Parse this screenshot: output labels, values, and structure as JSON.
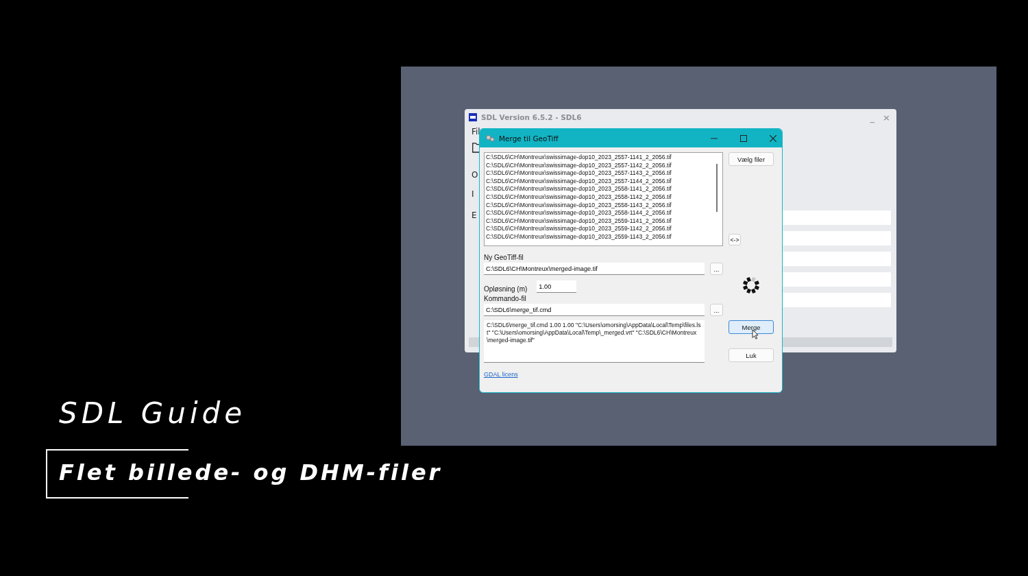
{
  "overlay": {
    "heading": "SDL Guide",
    "subtitle": "Flet billede- og DHM-filer"
  },
  "background_window": {
    "title": "SDL Version 6.5.2 - SDL6",
    "minimize_glyph": "_",
    "close_glyph": "×",
    "partial_labels": [
      "Fil",
      "O",
      "I",
      "E"
    ]
  },
  "dialog": {
    "title": "Merge til GeoTiff",
    "files": [
      "C:\\SDL6\\CH\\Montreux\\swissimage-dop10_2023_2557-1141_2_2056.tif",
      "C:\\SDL6\\CH\\Montreux\\swissimage-dop10_2023_2557-1142_2_2056.tif",
      "C:\\SDL6\\CH\\Montreux\\swissimage-dop10_2023_2557-1143_2_2056.tif",
      "C:\\SDL6\\CH\\Montreux\\swissimage-dop10_2023_2557-1144_2_2056.tif",
      "C:\\SDL6\\CH\\Montreux\\swissimage-dop10_2023_2558-1141_2_2056.tif",
      "C:\\SDL6\\CH\\Montreux\\swissimage-dop10_2023_2558-1142_2_2056.tif",
      "C:\\SDL6\\CH\\Montreux\\swissimage-dop10_2023_2558-1143_2_2056.tif",
      "C:\\SDL6\\CH\\Montreux\\swissimage-dop10_2023_2558-1144_2_2056.tif",
      "C:\\SDL6\\CH\\Montreux\\swissimage-dop10_2023_2559-1141_2_2056.tif",
      "C:\\SDL6\\CH\\Montreux\\swissimage-dop10_2023_2559-1142_2_2056.tif",
      "C:\\SDL6\\CH\\Montreux\\swissimage-dop10_2023_2559-1143_2_2056.tif"
    ],
    "choose_button": {
      "label": "Vælg filer",
      "focused": false
    },
    "swap_button": {
      "label": "<->",
      "focused": false
    },
    "output_label": "Ny GeoTiff-fil",
    "output_value": "C:\\SDL6\\CH\\Montreux\\merged-image.tif",
    "browse_label": "...",
    "resolution_label": "Opløsning (m)",
    "resolution_value": "1.00",
    "command_label": "Kommando-fil",
    "command_value": "C:\\SDL6\\merge_tif.cmd",
    "command_browse_label": "...",
    "command_line": "C:\\SDL6\\merge_tif.cmd 1.00 1.00 \"C:\\Users\\omorsing\\AppData\\Local\\Temp\\files.lst\" \"C:\\Users\\omorsing\\AppData\\Local\\Temp\\_merged.vrt\" \"C:\\SDL6\\CH\\Montreux\\merged-image.tif\"",
    "merge_button": {
      "label": "Merge",
      "focused": true
    },
    "close_button": {
      "label": "Luk",
      "focused": false
    },
    "license_link": "GDAL licens"
  }
}
